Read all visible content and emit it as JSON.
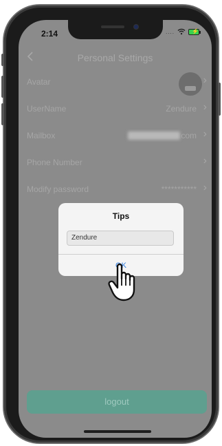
{
  "status_bar": {
    "time": "2:14",
    "signal": "...."
  },
  "nav": {
    "back_icon": "chevron-left-icon",
    "title": "Personal Settings"
  },
  "rows": [
    {
      "label": "Avatar",
      "value": ""
    },
    {
      "label": "UserName",
      "value": "Zendure"
    },
    {
      "label": "Mailbox",
      "value": ".com"
    },
    {
      "label": "Phone Number",
      "value": ""
    },
    {
      "label": "Modify password",
      "value": "***********"
    }
  ],
  "dialog": {
    "title": "Tips",
    "input_value": "Zendure",
    "ok_label": "OK"
  },
  "logout_label": "logout",
  "colors": {
    "accent": "#5f9f8f",
    "ok_blue": "#2c7be0",
    "overlay": "#8b8b8b"
  }
}
